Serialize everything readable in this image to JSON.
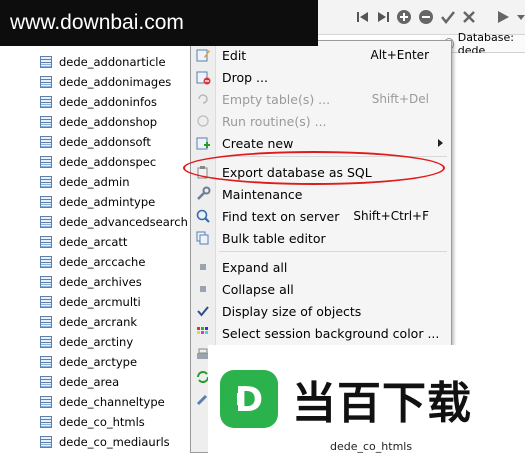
{
  "watermark": {
    "text": "www.downbai.com"
  },
  "tab": {
    "label": "Database: dede"
  },
  "tree": {
    "items": [
      "dede_addonarticle",
      "dede_addonimages",
      "dede_addoninfos",
      "dede_addonshop",
      "dede_addonsoft",
      "dede_addonspec",
      "dede_admin",
      "dede_admintype",
      "dede_advancedsearch",
      "dede_arcatt",
      "dede_arccache",
      "dede_archives",
      "dede_arcmulti",
      "dede_arcrank",
      "dede_arctiny",
      "dede_arctype",
      "dede_area",
      "dede_channeltype",
      "dede_co_htmls",
      "dede_co_mediaurls"
    ]
  },
  "menu": {
    "edit": {
      "label": "Edit",
      "shortcut": "Alt+Enter"
    },
    "drop": {
      "label": "Drop ..."
    },
    "empty_tables": {
      "label": "Empty table(s) ...",
      "shortcut": "Shift+Del"
    },
    "run_routines": {
      "label": "Run routine(s) ..."
    },
    "create_new": {
      "label": "Create new"
    },
    "export_sql": {
      "label": "Export database as SQL"
    },
    "maintenance": {
      "label": "Maintenance"
    },
    "find_text": {
      "label": "Find text on server",
      "shortcut": "Shift+Ctrl+F"
    },
    "bulk_editor": {
      "label": "Bulk table editor"
    },
    "expand_all": {
      "label": "Expand all"
    },
    "collapse_all": {
      "label": "Collapse all"
    },
    "display_size": {
      "label": "Display size of objects"
    },
    "session_bg": {
      "label": "Select session background color ..."
    }
  },
  "logo": {
    "text": "当百下载",
    "badge_letter": "D"
  },
  "bottom_peek": {
    "text": "dede_co_htmls"
  },
  "colors": {
    "highlight": "#e01b1b",
    "logo_green": "#2bb24c"
  }
}
